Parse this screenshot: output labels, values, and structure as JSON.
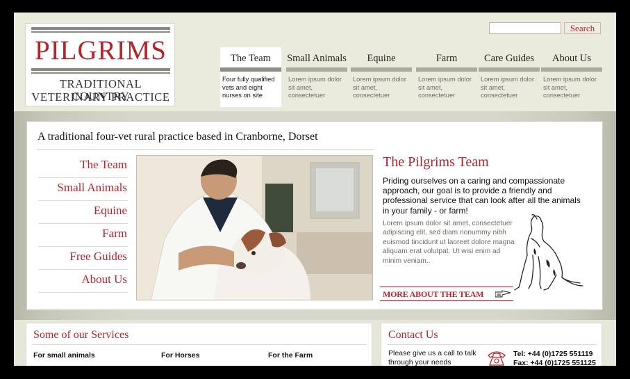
{
  "header": {
    "logo": {
      "title": "PILGRIMS",
      "line1": "TRADITIONAL COUNTRY",
      "line2": "VETERINARY PRACTICE"
    },
    "search": {
      "value": "",
      "button_label": "Search"
    },
    "nav": [
      {
        "label": "The Team",
        "desc": "Four fully qualified vets and eight nurses on site",
        "active": true
      },
      {
        "label": "Small Animals",
        "desc": "Lorem ipsum dolor sit amet, consectetuer"
      },
      {
        "label": "Equine",
        "desc": "Lorem ipsum dolor sit amet, consectetuer"
      },
      {
        "label": "Farm",
        "desc": "Lorem ipsum dolor sit amet, consectetuer"
      },
      {
        "label": "Care Guides",
        "desc": "Lorem ipsum dolor sit amet, consectetuer"
      },
      {
        "label": "About Us",
        "desc": "Lorem ipsum dolor sit amet, consectetuer"
      }
    ]
  },
  "main": {
    "tagline": "A traditional four-vet rural practice based in Cranborne, Dorset",
    "side_menu": [
      "The Team",
      "Small Animals",
      "Equine",
      "Farm",
      "Free Guides",
      "About Us"
    ],
    "team": {
      "heading": "The Pilgrims Team",
      "lead": "Priding ourselves on a caring and compassionate approach, our goal is to provide a friendly and professional service that can look after all the animals in your family - or farm!",
      "body": "Lorem ipsum dolor sit amet, consectetuer adipiscing elit, sed diam nonummy nibh euismod tincidunt ut laoreet dolore magna aliquam erat volutpat. Ut wisi enim ad minim veniam..",
      "more_link": "MORE ABOUT THE TEAM"
    }
  },
  "services": {
    "title": "Some of our Services",
    "columns": [
      "For small animals",
      "For Horses",
      "For the Farm"
    ]
  },
  "contact": {
    "title": "Contact Us",
    "text": "Please give us a call to talk through your needs",
    "tel": "Tel: +44 (0)1725 551119",
    "fax": "Fax: +44 (0)1725 551125"
  },
  "colors": {
    "brand_red": "#b3252b",
    "header_bg": "#eaeadd",
    "tab_bar": "#a9a99f"
  },
  "icons": [
    "search-icon",
    "hand-pointer-icon",
    "telephone-icon",
    "dog-sketch-illustration"
  ]
}
